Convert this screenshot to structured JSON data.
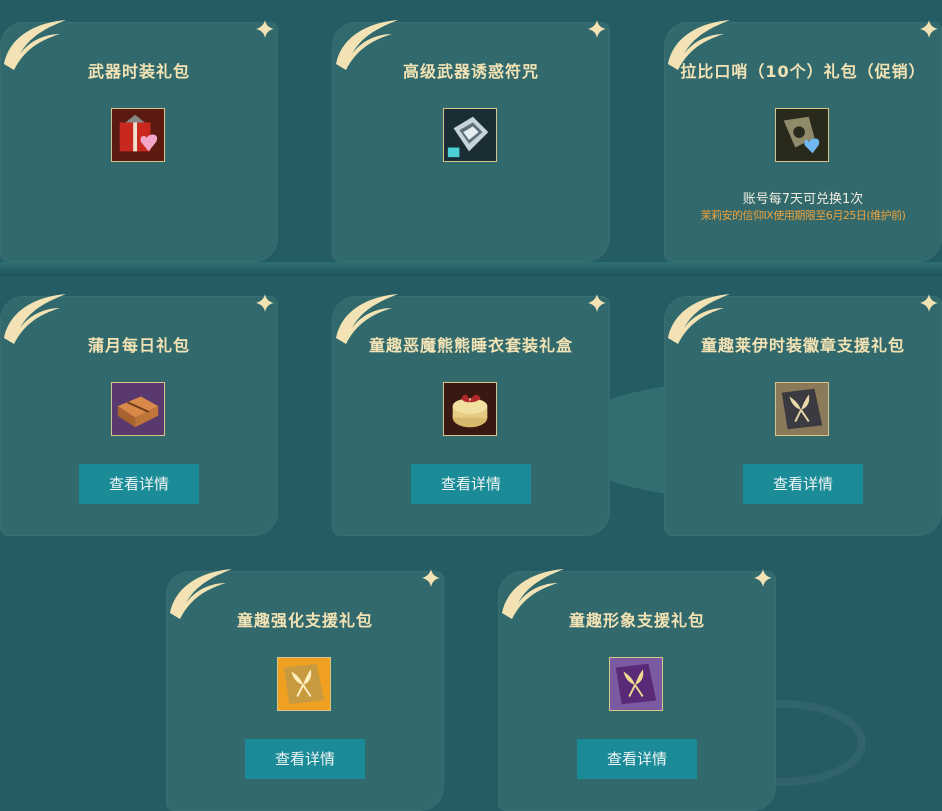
{
  "packages": [
    {
      "title": "武器时装礼包",
      "icon": "gift-box-heart-icon",
      "button_label": null
    },
    {
      "title": "高级武器诱惑符咒",
      "icon": "silver-talisman-icon",
      "button_label": null
    },
    {
      "title": "拉比口哨（10个）礼包（促销）",
      "icon": "whistle-heart-icon",
      "note": "账号每7天可兑换1次",
      "sub_note": "茉莉安的信仰IX使用期限至6月25日(维护前)"
    },
    {
      "title": "蒲月每日礼包",
      "icon": "brown-parcel-icon",
      "button_label": "查看详情"
    },
    {
      "title": "童趣恶魔熊熊睡衣套装礼盒",
      "icon": "round-gift-box-icon",
      "button_label": "查看详情"
    },
    {
      "title": "童趣莱伊时装徽章支援礼包",
      "icon": "dark-gift-box-icon",
      "button_label": "查看详情"
    },
    {
      "title": "童趣强化支援礼包",
      "icon": "gold-gift-box-icon",
      "button_label": "查看详情"
    },
    {
      "title": "童趣形象支援礼包",
      "icon": "purple-gift-box-icon",
      "button_label": "查看详情"
    }
  ],
  "colors": {
    "background": "#255c63",
    "card": "#31696d",
    "title_text": "#f3e3b4",
    "button": "#1b8b98",
    "sub_note": "#f0a23a"
  }
}
